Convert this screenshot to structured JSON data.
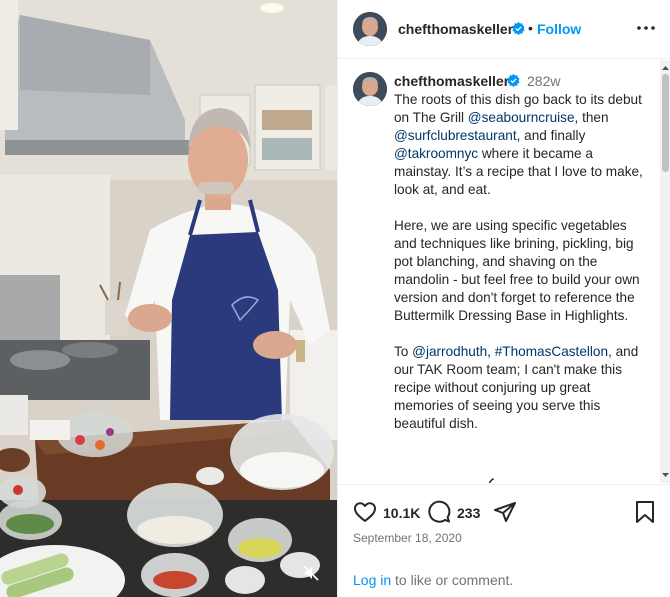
{
  "post": {
    "username": "chefthomaskeller",
    "follow_label": "Follow",
    "dot_separator": "•",
    "more_icon": "more-options-icon",
    "verified_icon": "verified-badge-icon"
  },
  "caption": {
    "username": "chefthomaskeller",
    "age": "282w",
    "paragraph1": {
      "t1": "The roots of this dish go back to its debut on The Grill ",
      "m1": "@seabourncruise",
      "t2": ", then ",
      "m2": "@surfclubrestaurant",
      "t3": ", and finally ",
      "m3": "@takroomnyc",
      "t4": " where it became a mainstay.  It’s a recipe that I love to make, look at, and eat."
    },
    "paragraph2": "Here, we are using specific vegetables and techniques like brining, pickling, big pot blanching, and shaving on the mandolin - but feel free to build your own version and don't forget to reference the Buttermilk Dressing Base in Highlights.",
    "paragraph3": {
      "t1": "To ",
      "m1": "@jarrodhuth",
      "t2": ", ",
      "m2": "#ThomasCastellon",
      "t3": ", and our TAK Room team; I can't make this recipe without conjuring up great memories of seeing you serve this beautiful dish."
    }
  },
  "actions": {
    "like_count": "10.1K",
    "comment_count": "233",
    "date": "September 18, 2020",
    "login_link": "Log in",
    "login_rest": " to like or comment.",
    "icons": [
      "heart-icon",
      "comment-icon",
      "share-icon",
      "bookmark-icon"
    ]
  },
  "media": {
    "mute_icon": "muted-speaker-icon"
  },
  "colors": {
    "link_blue": "#0095f6",
    "mention_blue": "#00376b",
    "muted_text": "#737373",
    "verified_blue": "#0095f6"
  }
}
